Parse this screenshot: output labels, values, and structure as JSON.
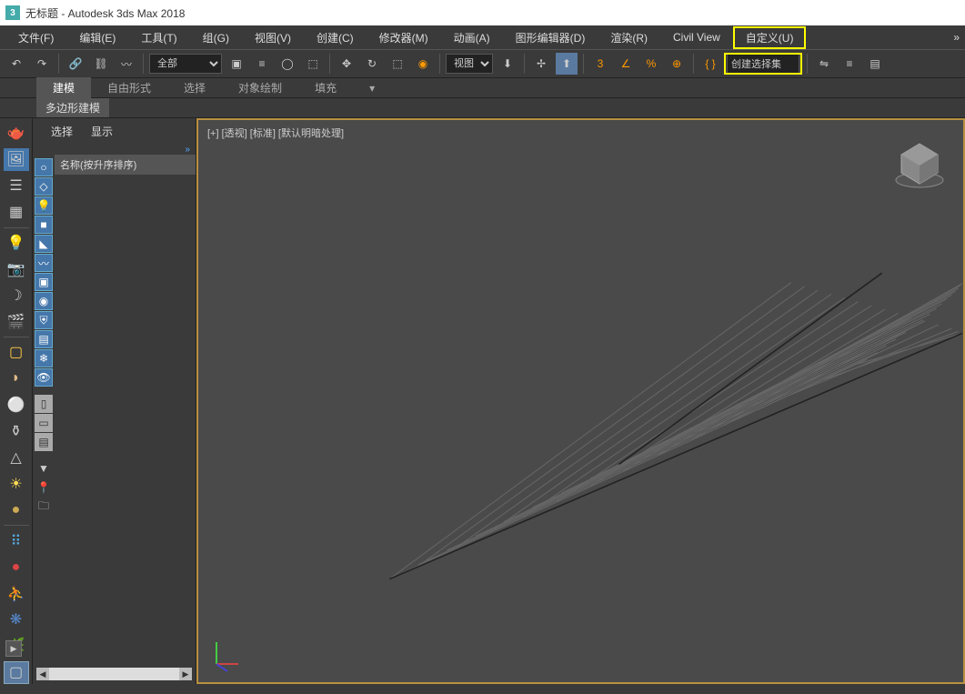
{
  "titlebar": {
    "icon_text": "3",
    "title": "无标题 - Autodesk 3ds Max 2018"
  },
  "menubar": {
    "items": [
      "文件(F)",
      "编辑(E)",
      "工具(T)",
      "组(G)",
      "视图(V)",
      "创建(C)",
      "修改器(M)",
      "动画(A)",
      "图形编辑器(D)",
      "渲染(R)",
      "Civil View",
      "自定义(U)"
    ],
    "expand": "»"
  },
  "toolbar": {
    "filter_label": "全部",
    "view_label": "视图",
    "selection_set": "创建选择集"
  },
  "ribbon": {
    "tabs": [
      "建模",
      "自由形式",
      "选择",
      "对象绘制",
      "填充"
    ],
    "active": 0,
    "sub": "多边形建模"
  },
  "scene": {
    "header": [
      "选择",
      "显示"
    ],
    "expand": "»",
    "list_header": "名称(按升序排序)"
  },
  "viewport": {
    "label": "[+] [透视] [标准] [默认明暗处理]"
  }
}
